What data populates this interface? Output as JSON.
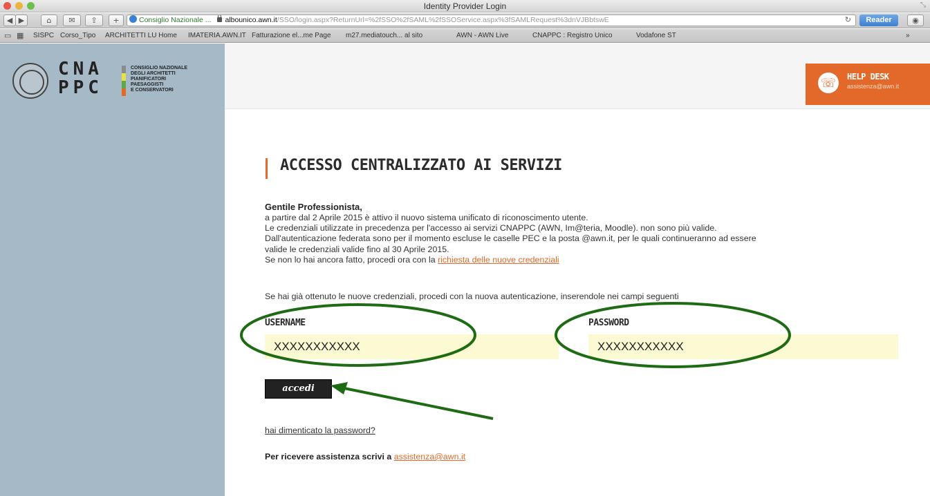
{
  "window": {
    "title": "Identity Provider Login"
  },
  "toolbar": {
    "site_name": "Consiglio Nazionale ...",
    "url_host": "albounico.awn.it",
    "url_path": "/SSO/login.aspx?ReturnUrl=%2fSSO%2fSAML%2fSSOService.aspx%3fSAMLRequest%3dnVJBbtswE",
    "reader_label": "Reader"
  },
  "bookmarks": [
    "SISPC",
    "Corso_Tipo",
    "ARCHITETTI LU Home",
    "IMATERIA.AWN.IT",
    "Fatturazione el...me Page",
    "m27.mediatouch... al sito",
    "AWN - AWN Live",
    "CNAPPC : Registro Unico",
    "Vodafone ST",
    "»"
  ],
  "logo": {
    "letters_top": "CNA",
    "letters_bottom": "PPC",
    "text_lines": [
      "Consiglio Nazionale",
      "degli Architetti",
      "Pianificatori",
      "Paesaggisti",
      "e Conservatori"
    ],
    "bar_colors": [
      "#8c8c8c",
      "#e8e04a",
      "#5fa84a",
      "#e2692a"
    ]
  },
  "helpdesk": {
    "title": "HELP DESK",
    "email": "assistenza@awn.it"
  },
  "main": {
    "heading": "ACCESSO CENTRALIZZATO AI SERVIZI",
    "greeting": "Gentile Professionista,",
    "lines": [
      "a partire dal 2 Aprile 2015 è attivo il nuovo sistema unificato di riconoscimento utente.",
      "Le credenziali utilizzate in precedenza per l'accesso ai servizi CNAPPC (AWN, Im@teria, Moodle). non sono più valide.",
      "Dall'autenticazione federata sono per il momento escluse le caselle PEC e la posta @awn.it, per le quali continueranno ad essere",
      "valide le credenziali valide fino al 30 Aprile 2015."
    ],
    "request_prefix": "Se non lo hai ancora fatto, procedi ora con la ",
    "request_link": "richiesta delle nuove credenziali",
    "note": "Se hai già ottenuto le nuove credenziali, procedi con la nuova autenticazione, inserendole nei campi seguenti"
  },
  "form": {
    "username_label": "USERNAME",
    "username_value": "XXXXXXXXXXX",
    "password_label": "PASSWORD",
    "password_value": "XXXXXXXXXXX",
    "submit_label": "accedi",
    "forgot_label": "hai dimenticato la password?",
    "assist_prefix": "Per ricevere assistenza scrivi a ",
    "assist_email": "assistenza@awn.it"
  },
  "colors": {
    "accent": "#e2692a",
    "sidebar": "#a6b9c7",
    "field_bg": "#fbfad2",
    "annotation": "#1d6b12"
  }
}
